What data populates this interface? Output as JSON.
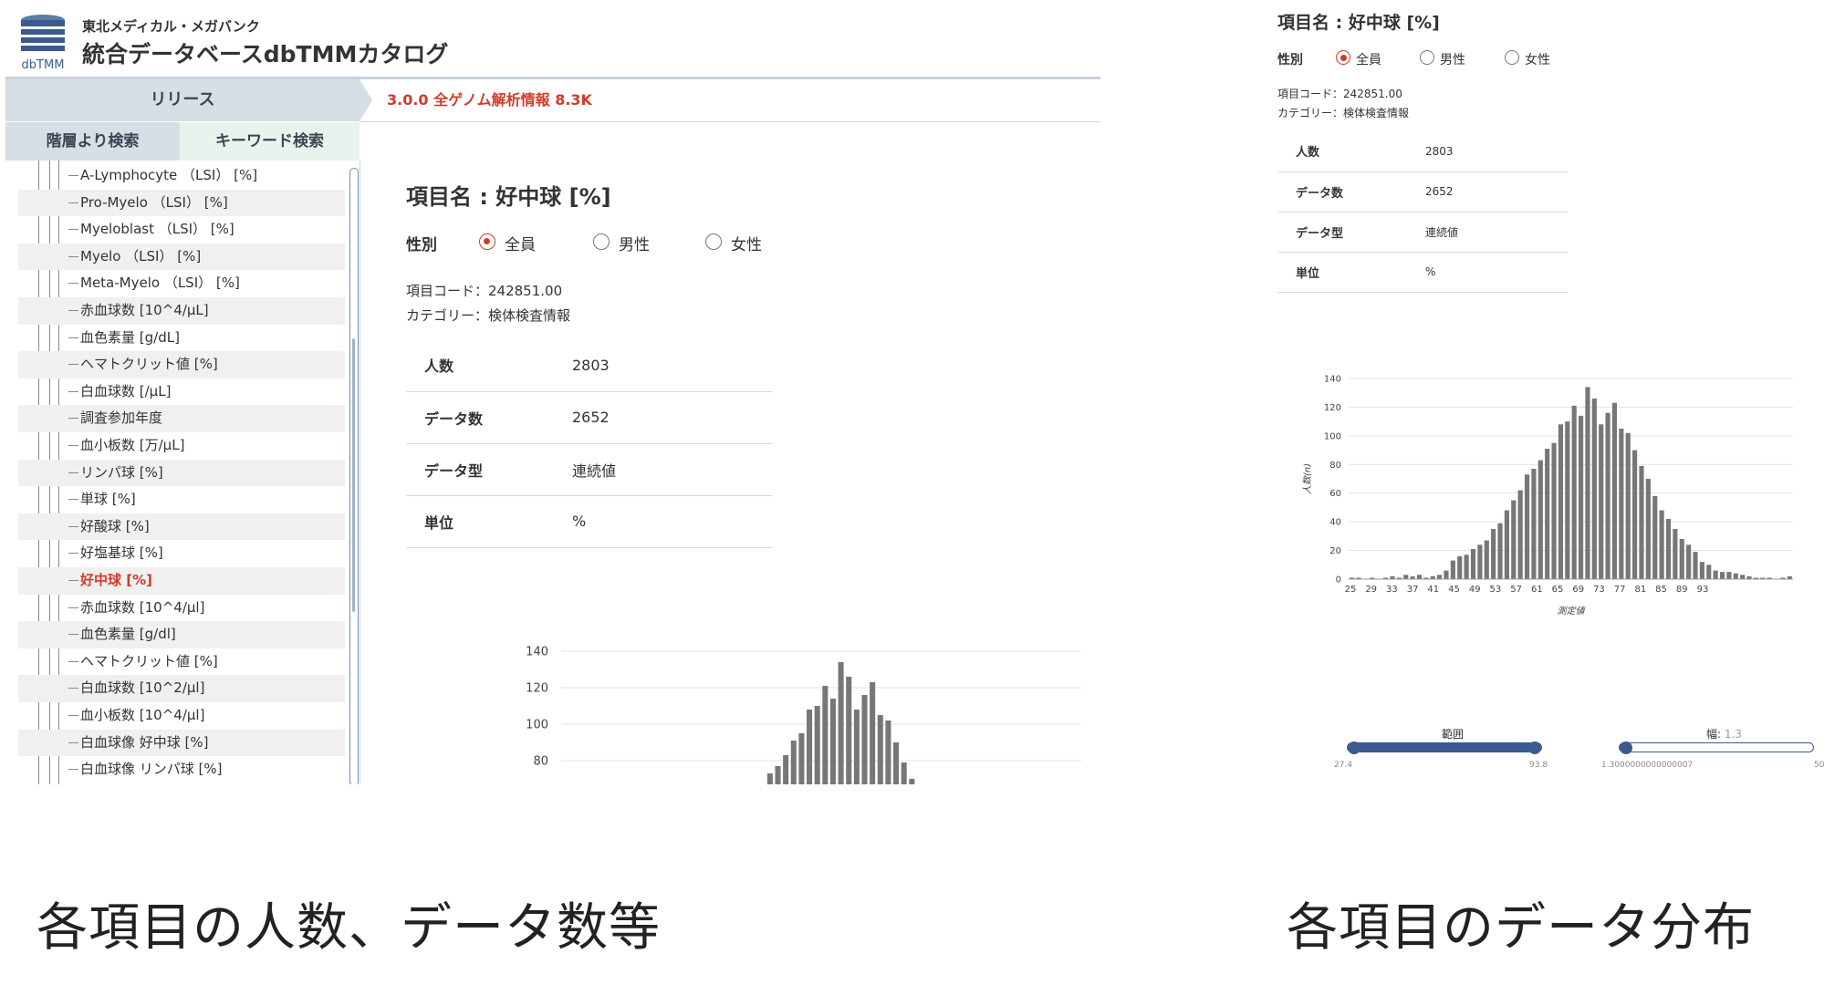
{
  "header": {
    "org": "東北メディカル・メガバンク",
    "title": "統合データベースdbTMMカタログ",
    "logo_text": "dbTMM"
  },
  "release": {
    "label": "リリース",
    "info": "3.0.0 全ゲノム解析情報 8.3K"
  },
  "search_tabs": [
    "階層より検索",
    "キーワード検索"
  ],
  "tree": {
    "items": [
      "A-Lymphocyte （LSI） [%]",
      "Pro-Myelo （LSI） [%]",
      "Myeloblast （LSI） [%]",
      "Myelo （LSI） [%]",
      "Meta-Myelo （LSI） [%]",
      "赤血球数 [10^4/μL]",
      "血色素量 [g/dL]",
      "ヘマトクリット値 [%]",
      "白血球数 [/μL]",
      "調査参加年度",
      "血小板数 [万/μL]",
      "リンパ球 [%]",
      "単球 [%]",
      "好酸球 [%]",
      "好塩基球 [%]",
      "好中球 [%]",
      "赤血球数 [10^4/μl]",
      "血色素量 [g/dl]",
      "ヘマトクリット値 [%]",
      "白血球数 [10^2/μl]",
      "血小板数 [10^4/μl]",
      "白血球像 好中球 [%]",
      "白血球像 リンパ球 [%]"
    ],
    "selected_index": 15
  },
  "detail": {
    "item_title": "項目名 : 好中球 [%]",
    "sex_label": "性別",
    "sex_options": [
      "全員",
      "男性",
      "女性"
    ],
    "sex_selected": "全員",
    "item_code": "項目コード：242851.00",
    "category": "カテゴリー：検体検査情報",
    "stats": [
      {
        "key": "人数",
        "value": "2803"
      },
      {
        "key": "データ数",
        "value": "2652"
      },
      {
        "key": "データ型",
        "value": "連続値"
      },
      {
        "key": "単位",
        "value": "%"
      }
    ]
  },
  "chart_data": {
    "type": "bar",
    "xlabel": "測定値",
    "ylabel": "人数(n)",
    "ylim": [
      0,
      140
    ],
    "yticks": [
      0,
      20,
      40,
      60,
      80,
      100,
      120,
      140
    ],
    "xticks": [
      "25",
      "29",
      "33",
      "37",
      "41",
      "45",
      "49",
      "53",
      "57",
      "61",
      "65",
      "69",
      "73",
      "77",
      "81",
      "85",
      "89",
      "93"
    ],
    "x_start": 25.3,
    "bin_width": 1.3,
    "values": [
      1,
      1,
      0,
      1,
      0,
      1,
      2,
      1,
      3,
      2,
      3,
      1,
      2,
      3,
      6,
      13,
      16,
      17,
      21,
      24,
      27,
      35,
      39,
      48,
      55,
      62,
      73,
      77,
      83,
      91,
      95,
      108,
      110,
      121,
      114,
      134,
      126,
      108,
      116,
      123,
      105,
      102,
      90,
      79,
      70,
      58,
      48,
      42,
      35,
      28,
      24,
      19,
      12,
      10,
      6,
      5,
      5,
      4,
      3,
      2,
      1,
      1,
      1,
      0,
      1,
      2
    ],
    "grid": true
  },
  "sliders": {
    "range": {
      "label": "範囲",
      "min_label": "27.4",
      "max_label": "93.8",
      "low": 0.0,
      "high": 1.0
    },
    "width": {
      "label": "幅: ",
      "value": "1.3",
      "min_label": "1.3000000000000007",
      "max_label": "50",
      "level": 0.0
    }
  },
  "captions": {
    "left": "各項目の人数、データ数等",
    "right": "各項目のデータ分布"
  }
}
